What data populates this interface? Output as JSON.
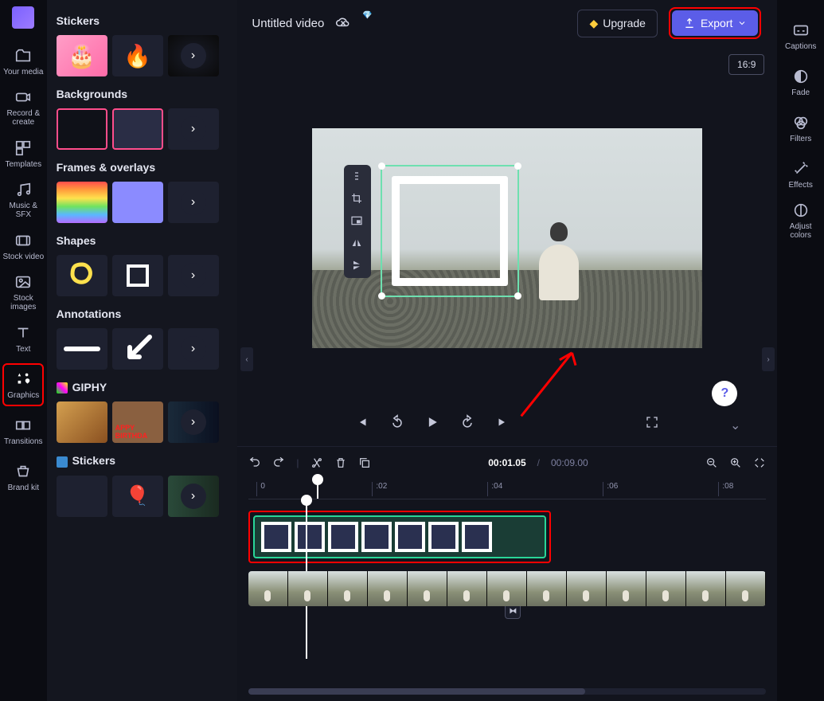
{
  "nav": {
    "items": [
      {
        "label": "Your media",
        "icon": "folder"
      },
      {
        "label": "Record & create",
        "icon": "camera"
      },
      {
        "label": "Templates",
        "icon": "templates"
      },
      {
        "label": "Music & SFX",
        "icon": "music"
      },
      {
        "label": "Stock video",
        "icon": "stockvideo"
      },
      {
        "label": "Stock images",
        "icon": "stockimage"
      },
      {
        "label": "Text",
        "icon": "text"
      },
      {
        "label": "Graphics",
        "icon": "graphics"
      },
      {
        "label": "Transitions",
        "icon": "transitions"
      },
      {
        "label": "Brand kit",
        "icon": "brandkit"
      }
    ]
  },
  "panel": {
    "sections": [
      {
        "title": "Stickers"
      },
      {
        "title": "Backgrounds"
      },
      {
        "title": "Frames & overlays"
      },
      {
        "title": "Shapes"
      },
      {
        "title": "Annotations"
      },
      {
        "title": "GIPHY"
      },
      {
        "title": "Stickers"
      }
    ]
  },
  "header": {
    "title": "Untitled video",
    "upgrade": "Upgrade",
    "export": "Export",
    "aspect": "16:9"
  },
  "timeline": {
    "current": "00:01.05",
    "total": "00:09.00",
    "ticks": [
      "0",
      ":02",
      ":04",
      ":06",
      ":08"
    ]
  },
  "rpanel": {
    "items": [
      {
        "label": "Captions",
        "icon": "captions"
      },
      {
        "label": "Fade",
        "icon": "fade"
      },
      {
        "label": "Filters",
        "icon": "filters"
      },
      {
        "label": "Effects",
        "icon": "effects"
      },
      {
        "label": "Adjust colors",
        "icon": "adjust"
      }
    ]
  },
  "help": "?"
}
